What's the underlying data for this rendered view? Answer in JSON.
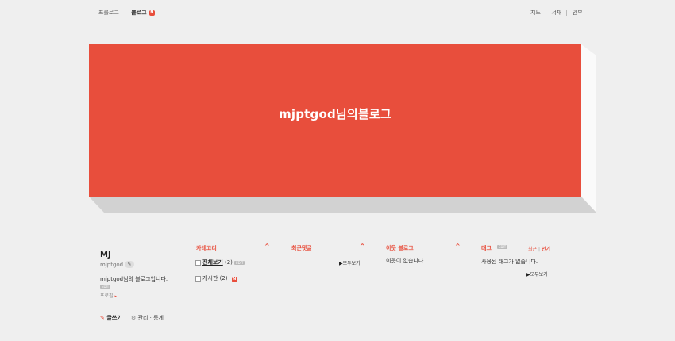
{
  "topnav": {
    "items": [
      {
        "label": "프롤로그"
      },
      {
        "label": "블로그",
        "badge": "N"
      }
    ],
    "right_links": [
      "지도",
      "서재",
      "안부"
    ]
  },
  "banner": {
    "title": "mjptgod님의블로그",
    "color": "#e84e3c"
  },
  "profile": {
    "nickname": "MJ",
    "id": "mjptgod",
    "description": "mjptgod님의 블로그입니다.",
    "edit_label": "EDIT",
    "profile_link": "프로필",
    "write_label": "글쓰기",
    "admin_label": "관리",
    "stats_label": "통계",
    "dot": "·"
  },
  "categories": {
    "title": "카테고리",
    "items": [
      {
        "label": "전체보기",
        "count": "(2)",
        "tag": "EDIT"
      },
      {
        "label": "게시판",
        "count": "(2)",
        "badge": "N"
      }
    ]
  },
  "comments": {
    "title": "최근댓글",
    "more": "모두보기"
  },
  "neighbors": {
    "title": "이웃 블로그",
    "empty": "이웃이 없습니다."
  },
  "tags": {
    "title": "태그",
    "edit_label": "EDIT",
    "tab_recent": "최근",
    "tab_popular": "인기",
    "tab_sep": "|",
    "empty": "사용된 태그가 없습니다.",
    "more": "모두보기"
  },
  "icons": {
    "caret": "^",
    "triangle": "▶",
    "pen": "✎",
    "gear": "⚙",
    "arrow": "▸",
    "pencil": "✎"
  }
}
